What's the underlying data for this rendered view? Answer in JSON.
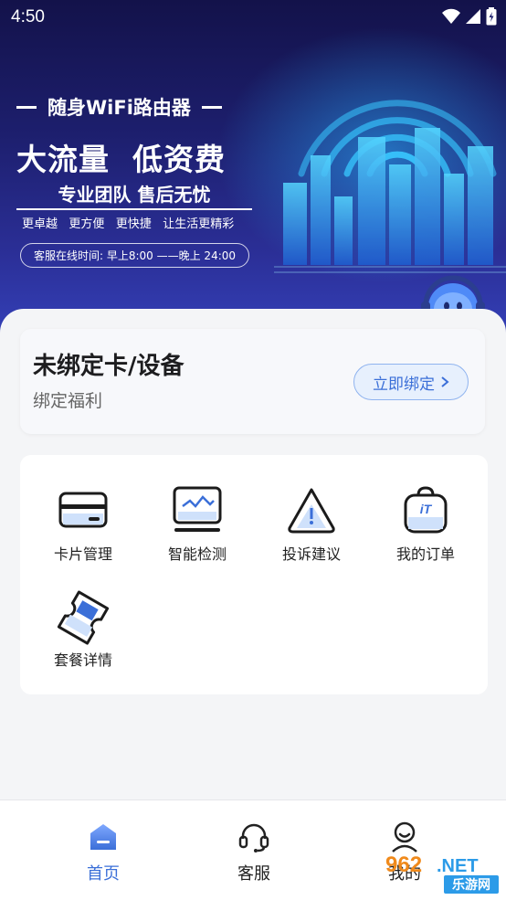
{
  "status_bar": {
    "time": "4:50"
  },
  "banner": {
    "title": "随身WiFi路由器",
    "headline": "大流量  低资费",
    "subheadline": "专业团队 售后无忧",
    "tags": "更卓越   更方便   更快捷   让生活更精彩",
    "service_hours": "客服在线时间: 早上8:00 ——晚上 24:00"
  },
  "bind_card": {
    "title": "未绑定卡/设备",
    "subtitle": "绑定福利",
    "button_label": "立即绑定",
    "button_icon": "chevron-right-icon"
  },
  "features": [
    {
      "label": "卡片管理",
      "icon": "card-icon"
    },
    {
      "label": "智能检测",
      "icon": "monitor-icon"
    },
    {
      "label": "投诉建议",
      "icon": "warning-icon"
    },
    {
      "label": "我的订单",
      "icon": "order-bag-icon"
    },
    {
      "label": "套餐详情",
      "icon": "package-ticket-icon"
    }
  ],
  "bottom_nav": [
    {
      "label": "首页",
      "icon": "home-icon",
      "active": true
    },
    {
      "label": "客服",
      "icon": "headset-icon",
      "active": false
    },
    {
      "label": "我的",
      "icon": "user-icon",
      "active": false
    }
  ],
  "watermark": {
    "number": "962",
    "suffix": ".NET",
    "text": "乐游网"
  },
  "colors": {
    "accent": "#3b6fd8",
    "banner_dark": "#13124a",
    "background": "#f4f5f7",
    "nav_active": "#3b6fd8",
    "watermark_orange": "#f08a1c"
  }
}
